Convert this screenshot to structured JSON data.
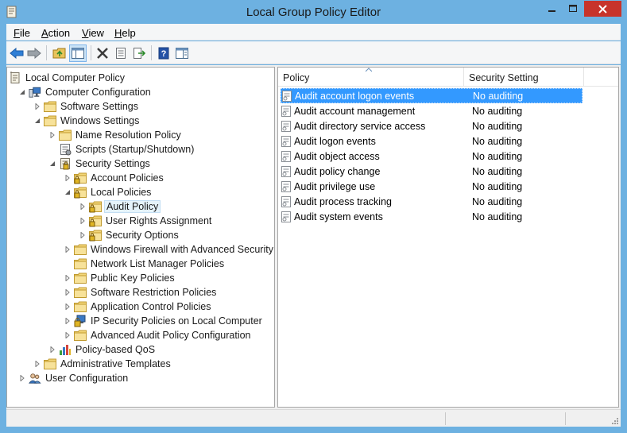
{
  "window": {
    "title": "Local Group Policy Editor",
    "accent_color": "#6db1e1",
    "close_color": "#c7342b",
    "selection_color": "#3399ff"
  },
  "menubar": {
    "items": [
      {
        "label": "File",
        "accel": "F",
        "rest": "ile"
      },
      {
        "label": "Action",
        "accel": "A",
        "rest": "ction"
      },
      {
        "label": "View",
        "accel": "V",
        "rest": "iew"
      },
      {
        "label": "Help",
        "accel": "H",
        "rest": "elp"
      }
    ]
  },
  "toolbar": {
    "buttons": [
      "back-arrow-icon",
      "forward-arrow-icon",
      "up-folder-icon",
      "show-hide-tree-icon",
      "delete-icon",
      "properties-icon",
      "export-list-icon",
      "help-icon",
      "show-hide-action-pane-icon"
    ]
  },
  "tree": {
    "items": [
      {
        "label": "Local Computer Policy",
        "icon": "policy-document-icon",
        "expander": "none",
        "level": 0
      },
      {
        "label": "Computer Configuration",
        "icon": "computer-icon",
        "expander": "expanded",
        "level": 1
      },
      {
        "label": "Software Settings",
        "icon": "folder-icon",
        "expander": "collapsed",
        "level": 2
      },
      {
        "label": "Windows Settings",
        "icon": "folder-icon",
        "expander": "expanded",
        "level": 2
      },
      {
        "label": "Name Resolution Policy",
        "icon": "folder-icon",
        "expander": "collapsed",
        "level": 3
      },
      {
        "label": "Scripts (Startup/Shutdown)",
        "icon": "scripts-icon",
        "expander": "none",
        "level": 3
      },
      {
        "label": "Security Settings",
        "icon": "security-settings-icon",
        "expander": "expanded",
        "level": 3
      },
      {
        "label": "Account Policies",
        "icon": "locked-folder-icon",
        "expander": "collapsed",
        "level": 4
      },
      {
        "label": "Local Policies",
        "icon": "locked-folder-icon",
        "expander": "expanded",
        "level": 4
      },
      {
        "label": "Audit Policy",
        "icon": "locked-folder-icon",
        "expander": "collapsed",
        "level": 5,
        "selected": true
      },
      {
        "label": "User Rights Assignment",
        "icon": "locked-folder-icon",
        "expander": "collapsed",
        "level": 5
      },
      {
        "label": "Security Options",
        "icon": "locked-folder-icon",
        "expander": "collapsed",
        "level": 5
      },
      {
        "label": "Windows Firewall with Advanced Security",
        "icon": "folder-icon",
        "expander": "collapsed",
        "level": 4
      },
      {
        "label": "Network List Manager Policies",
        "icon": "folder-icon",
        "expander": "none",
        "level": 4
      },
      {
        "label": "Public Key Policies",
        "icon": "folder-icon",
        "expander": "collapsed",
        "level": 4
      },
      {
        "label": "Software Restriction Policies",
        "icon": "folder-icon",
        "expander": "collapsed",
        "level": 4
      },
      {
        "label": "Application Control Policies",
        "icon": "folder-icon",
        "expander": "collapsed",
        "level": 4
      },
      {
        "label": "IP Security Policies on Local Computer",
        "icon": "ip-security-icon",
        "expander": "collapsed",
        "level": 4
      },
      {
        "label": "Advanced Audit Policy Configuration",
        "icon": "folder-icon",
        "expander": "collapsed",
        "level": 4
      },
      {
        "label": "Policy-based QoS",
        "icon": "qos-chart-icon",
        "expander": "collapsed",
        "level": 3
      },
      {
        "label": "Administrative Templates",
        "icon": "folder-icon",
        "expander": "collapsed",
        "level": 2
      },
      {
        "label": "User Configuration",
        "icon": "users-icon",
        "expander": "collapsed",
        "level": 1
      }
    ]
  },
  "list": {
    "columns": [
      "Policy",
      "Security Setting"
    ],
    "sort_column": "Policy",
    "rows": [
      {
        "policy": "Audit account logon events",
        "setting": "No auditing",
        "selected": true
      },
      {
        "policy": "Audit account management",
        "setting": "No auditing"
      },
      {
        "policy": "Audit directory service access",
        "setting": "No auditing"
      },
      {
        "policy": "Audit logon events",
        "setting": "No auditing"
      },
      {
        "policy": "Audit object access",
        "setting": "No auditing"
      },
      {
        "policy": "Audit policy change",
        "setting": "No auditing"
      },
      {
        "policy": "Audit privilege use",
        "setting": "No auditing"
      },
      {
        "policy": "Audit process tracking",
        "setting": "No auditing"
      },
      {
        "policy": "Audit system events",
        "setting": "No auditing"
      }
    ]
  }
}
